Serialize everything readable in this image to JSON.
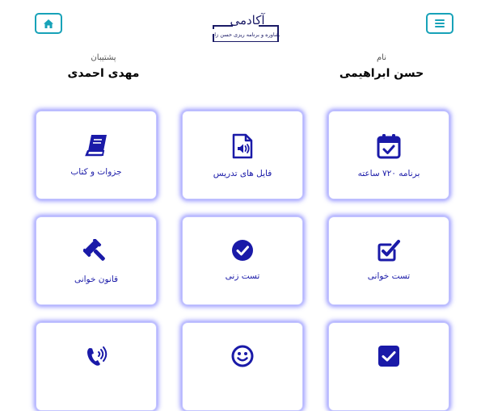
{
  "header": {
    "logo_title": "آکادمی",
    "logo_subtitle": "مشاوره و برنامه ریزی حسن زاده",
    "home_icon": "home-icon",
    "menu_icon": "hamburger-menu-icon"
  },
  "student": {
    "label": "نام",
    "name": "حسن ابراهیمی"
  },
  "supporter": {
    "label": "پشتیبان",
    "name": "مهدی احمدی"
  },
  "cards": [
    {
      "label": "برنامه ۷۲۰ ساعته",
      "icon": "calendar-check-icon"
    },
    {
      "label": "فایل های تدریس",
      "icon": "audio-file-icon"
    },
    {
      "label": "جزوات و کتاب",
      "icon": "book-icon"
    },
    {
      "label": "تست خوانی",
      "icon": "checkbox-edit-icon"
    },
    {
      "label": "تست زنی",
      "icon": "check-circle-icon"
    },
    {
      "label": "قانون خوانی",
      "icon": "gavel-icon"
    },
    {
      "label": "",
      "icon": "check-square-icon"
    },
    {
      "label": "",
      "icon": "smile-icon"
    },
    {
      "label": "",
      "icon": "phone-volume-icon"
    }
  ],
  "colors": {
    "accent": "#17a2b8",
    "primary": "#1a1aa8",
    "glow": "#4040ff"
  }
}
